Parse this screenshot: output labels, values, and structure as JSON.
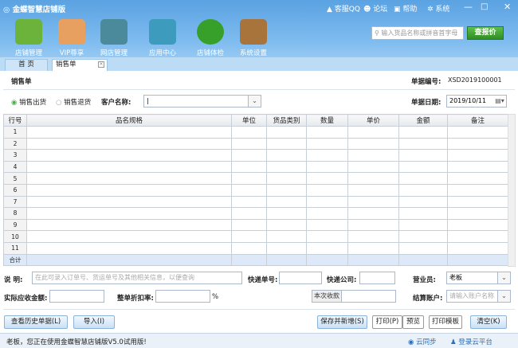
{
  "app": {
    "title": "金蝶智慧店铺版",
    "sys": [
      "客服QQ",
      "论坛",
      "帮助",
      "系统"
    ]
  },
  "toolbar": [
    {
      "label": "店铺管理",
      "color": "#6bb33a"
    },
    {
      "label": "VIP尊享",
      "color": "#e8a060"
    },
    {
      "label": "网店管理",
      "color": "#4a8a9a"
    },
    {
      "label": "应用中心",
      "color": "#3d9bbd"
    },
    {
      "label": "店铺体检",
      "color": "#36a02a"
    },
    {
      "label": "系统设置",
      "color": "#a8743c"
    }
  ],
  "search": {
    "placeholder": "输入货品名称或拼音首字母",
    "button": "查报价"
  },
  "tabs": [
    "首 页",
    "销售单"
  ],
  "form": {
    "title": "销售单",
    "doc_no_label": "单据编号:",
    "doc_no": "XSD2019100001",
    "radio_out": "销售出货",
    "radio_return": "销售退货",
    "customer_label": "客户名称:",
    "date_label": "单据日期:",
    "date": "2019/10/11"
  },
  "table": {
    "headers": [
      "行号",
      "品名规格",
      "单位",
      "货品类别",
      "数量",
      "单价",
      "金额",
      "备注"
    ],
    "rows": [
      "1",
      "2",
      "3",
      "4",
      "5",
      "6",
      "7",
      "8",
      "9",
      "10",
      "11"
    ],
    "total_label": "合计"
  },
  "footer": {
    "note_label": "说 明:",
    "note_placeholder": "在此可录入订单号、货运单号及其他相关信息，以便查询",
    "express_no_label": "快递单号:",
    "express_co_label": "快递公司:",
    "clerk_label": "营业员:",
    "clerk": "老板",
    "actual_label": "实际应收金额:",
    "discount_label": "整单折扣率:",
    "percent": "%",
    "receive_btn": "本次收款",
    "account_label": "结算账户:",
    "account_placeholder": "请输入账户名称"
  },
  "buttons": {
    "history": "查看历史单据(L)",
    "import": "导入(I)",
    "save_new": "保存并新增(S)",
    "print": "打印(P)",
    "preview": "预览",
    "template": "打印模板",
    "clear": "清空(K)"
  },
  "status": {
    "text": "老板，您正在使用金蝶智慧店铺版V5.0试用版!",
    "sync": "云同步",
    "login": "登录云平台"
  }
}
